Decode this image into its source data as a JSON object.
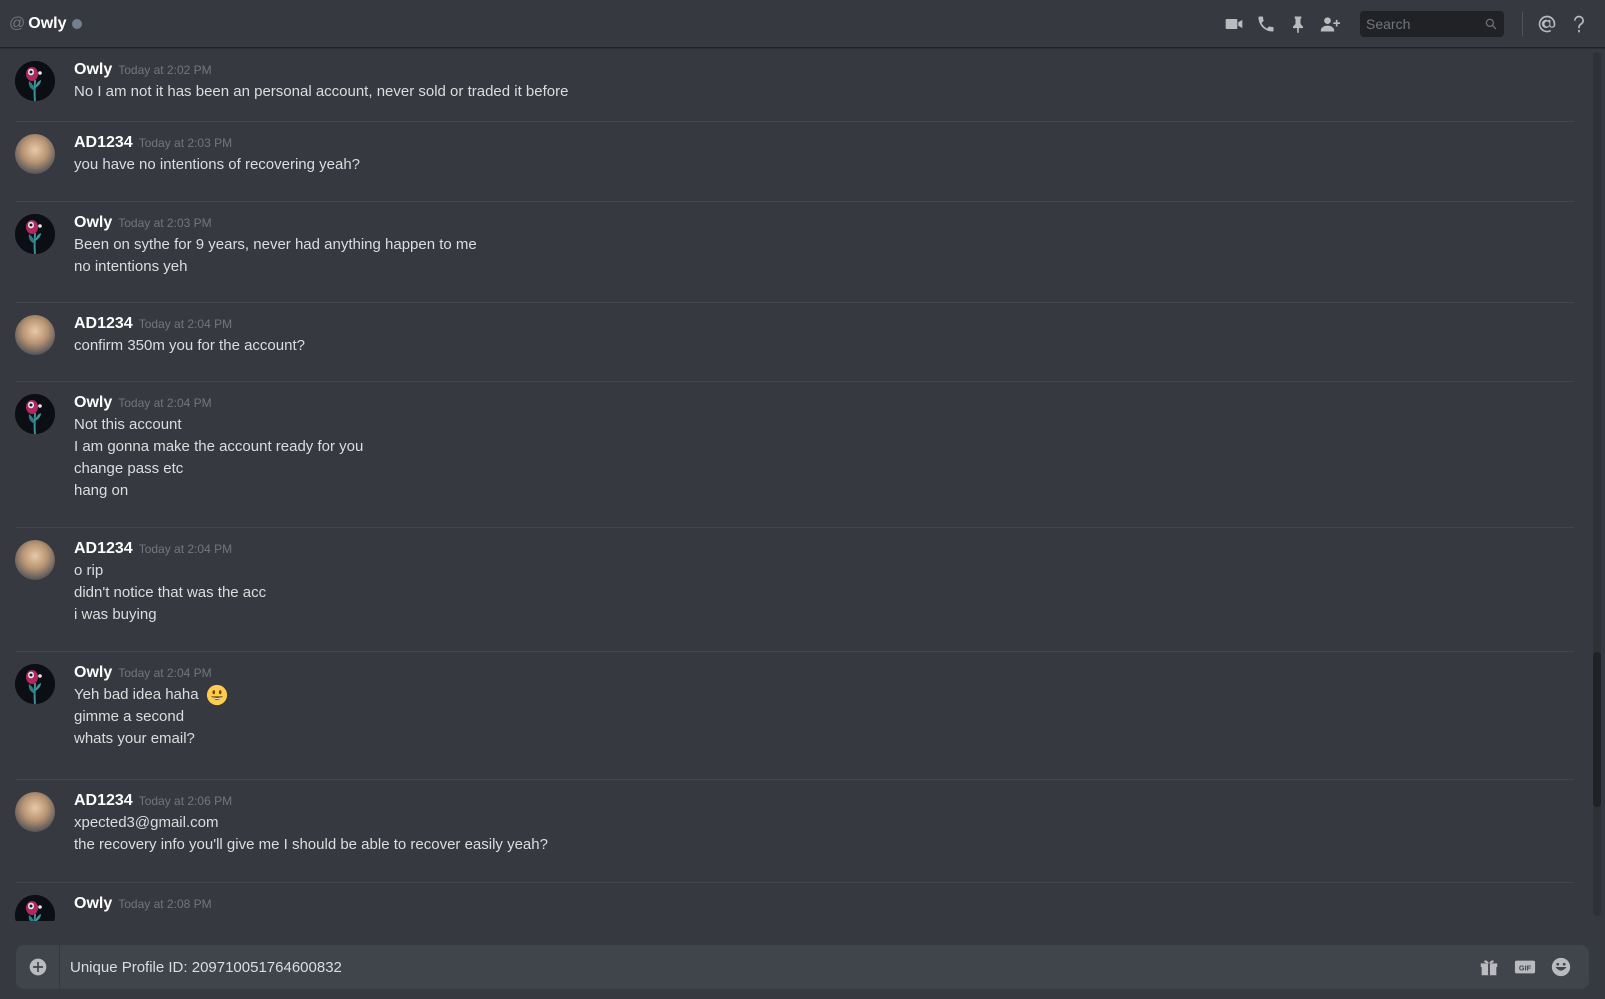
{
  "header": {
    "at_symbol": "@",
    "title": "Owly",
    "search_placeholder": "Search"
  },
  "messages": [
    {
      "user": "Owly",
      "time": "Today at 2:02 PM",
      "lines": [
        "No I am not it has been an personal account, never sold or traded it before"
      ]
    },
    {
      "user": "AD1234",
      "time": "Today at 2:03 PM",
      "lines": [
        "you have no intentions of recovering yeah?"
      ]
    },
    {
      "user": "Owly",
      "time": "Today at 2:03 PM",
      "lines": [
        "Been on sythe for 9 years, never had anything happen to me",
        "no intentions yeh"
      ]
    },
    {
      "user": "AD1234",
      "time": "Today at 2:04 PM",
      "lines": [
        "confirm 350m you for the account?"
      ]
    },
    {
      "user": "Owly",
      "time": "Today at 2:04 PM",
      "lines": [
        "Not this account",
        "I am gonna make the account ready for you",
        "change pass etc",
        "hang on"
      ]
    },
    {
      "user": "AD1234",
      "time": "Today at 2:04 PM",
      "lines": [
        "o rip",
        "didn't notice that was the acc",
        "i was buying"
      ]
    },
    {
      "user": "Owly",
      "time": "Today at 2:04 PM",
      "lines": [
        "Yeh bad idea haha",
        "gimme a second",
        "whats your email?"
      ]
    },
    {
      "user": "AD1234",
      "time": "Today at 2:06 PM",
      "lines": [
        "xpected3@gmail.com",
        "the recovery info you'll give me I should be able to recover easily yeah?"
      ]
    },
    {
      "user": "Owly",
      "time": "Today at 2:08 PM",
      "lines": []
    }
  ],
  "composer": {
    "text": "Unique Profile ID: 209710051764600832",
    "gif_label": "GIF"
  },
  "colors": {
    "background": "#36393f",
    "composer": "#40444b",
    "username": "#ffffff",
    "timestamp": "#72767d"
  }
}
